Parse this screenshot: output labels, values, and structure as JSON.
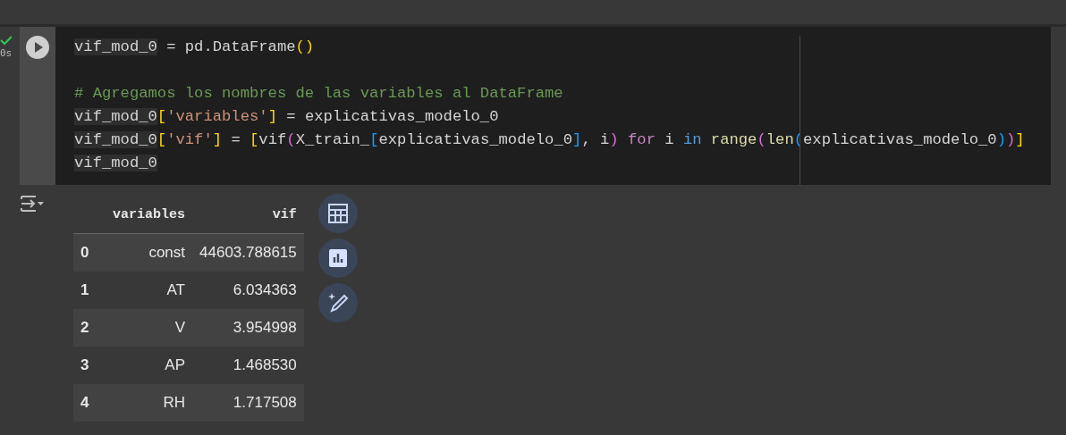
{
  "cell": {
    "status": {
      "succeeded": true,
      "duration": "0s"
    },
    "code_lines": [
      {
        "tokens": [
          {
            "kind": "var",
            "text": "vif_mod_0"
          },
          {
            "kind": "plain",
            "text": " = pd.DataFrame"
          },
          {
            "kind": "b1",
            "text": "()"
          }
        ]
      },
      {
        "gap_before": true,
        "tokens": [
          {
            "kind": "comment",
            "text": "# Agregamos los nombres de las variables al DataFrame"
          }
        ]
      },
      {
        "tokens": [
          {
            "kind": "var",
            "text": "vif_mod_0"
          },
          {
            "kind": "b1",
            "text": "["
          },
          {
            "kind": "str",
            "text": "'variables'"
          },
          {
            "kind": "b1",
            "text": "]"
          },
          {
            "kind": "plain",
            "text": " = explicativas_modelo_0"
          }
        ]
      },
      {
        "tokens": [
          {
            "kind": "var",
            "text": "vif_mod_0"
          },
          {
            "kind": "b1",
            "text": "["
          },
          {
            "kind": "str",
            "text": "'vif'"
          },
          {
            "kind": "b1",
            "text": "]"
          },
          {
            "kind": "plain",
            "text": " = "
          },
          {
            "kind": "b1",
            "text": "["
          },
          {
            "kind": "plain",
            "text": "vif"
          },
          {
            "kind": "b2",
            "text": "("
          },
          {
            "kind": "plain",
            "text": "X_train_"
          },
          {
            "kind": "b3",
            "text": "["
          },
          {
            "kind": "plain",
            "text": "explicativas_modelo_0"
          },
          {
            "kind": "b3",
            "text": "]"
          },
          {
            "kind": "plain",
            "text": ", i"
          },
          {
            "kind": "b2",
            "text": ")"
          },
          {
            "kind": "kw",
            "text": " for"
          },
          {
            "kind": "plain",
            "text": " i "
          },
          {
            "kind": "kw2",
            "text": "in"
          },
          {
            "kind": "fn",
            "text": " range"
          },
          {
            "kind": "b2",
            "text": "("
          },
          {
            "kind": "fn",
            "text": "len"
          },
          {
            "kind": "b3",
            "text": "("
          },
          {
            "kind": "plain",
            "text": "explicativas_modelo_0"
          },
          {
            "kind": "b3",
            "text": ")"
          },
          {
            "kind": "b2",
            "text": ")"
          },
          {
            "kind": "b1",
            "text": "]"
          }
        ]
      },
      {
        "tokens": [
          {
            "kind": "var",
            "text": "vif_mod_0"
          }
        ]
      }
    ]
  },
  "output": {
    "table": {
      "columns": [
        "",
        "variables",
        "vif"
      ],
      "rows": [
        [
          "0",
          "const",
          "44603.788615"
        ],
        [
          "1",
          "AT",
          "6.034363"
        ],
        [
          "2",
          "V",
          "3.954998"
        ],
        [
          "3",
          "AP",
          "1.468530"
        ],
        [
          "4",
          "RH",
          "1.717508"
        ]
      ]
    }
  }
}
